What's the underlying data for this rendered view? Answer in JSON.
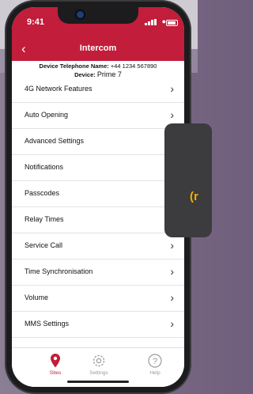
{
  "status": {
    "time": "9:41"
  },
  "header": {
    "back_icon": "chevron-left-icon",
    "title": "Intercom"
  },
  "device": {
    "phone_label": "Device Telephone Name:",
    "phone_value": "+44 1234 567890",
    "device_label": "Device:",
    "device_value": "Prime 7"
  },
  "menu": [
    {
      "label": "4G Network Features",
      "chevron": true
    },
    {
      "label": "Auto Opening",
      "chevron": true
    },
    {
      "label": "Advanced Settings",
      "chevron": false
    },
    {
      "label": "Notifications",
      "chevron": false
    },
    {
      "label": "Passcodes",
      "chevron": false
    },
    {
      "label": "Relay Times",
      "chevron": false
    },
    {
      "label": "Service Call",
      "chevron": true
    },
    {
      "label": "Time Synchronisation",
      "chevron": true
    },
    {
      "label": "Volume",
      "chevron": true
    },
    {
      "label": "MMS Settings",
      "chevron": true
    }
  ],
  "tabs": [
    {
      "label": "Sites",
      "icon": "location-pin-icon",
      "active": true
    },
    {
      "label": "Settings",
      "icon": "gear-icon",
      "active": false
    },
    {
      "label": "Help",
      "icon": "help-icon",
      "active": false
    }
  ],
  "overlay": {
    "text": "(r"
  },
  "colors": {
    "accent": "#c21d3a",
    "overlay_bg": "#3c3c3e",
    "overlay_text": "#f2b000"
  }
}
